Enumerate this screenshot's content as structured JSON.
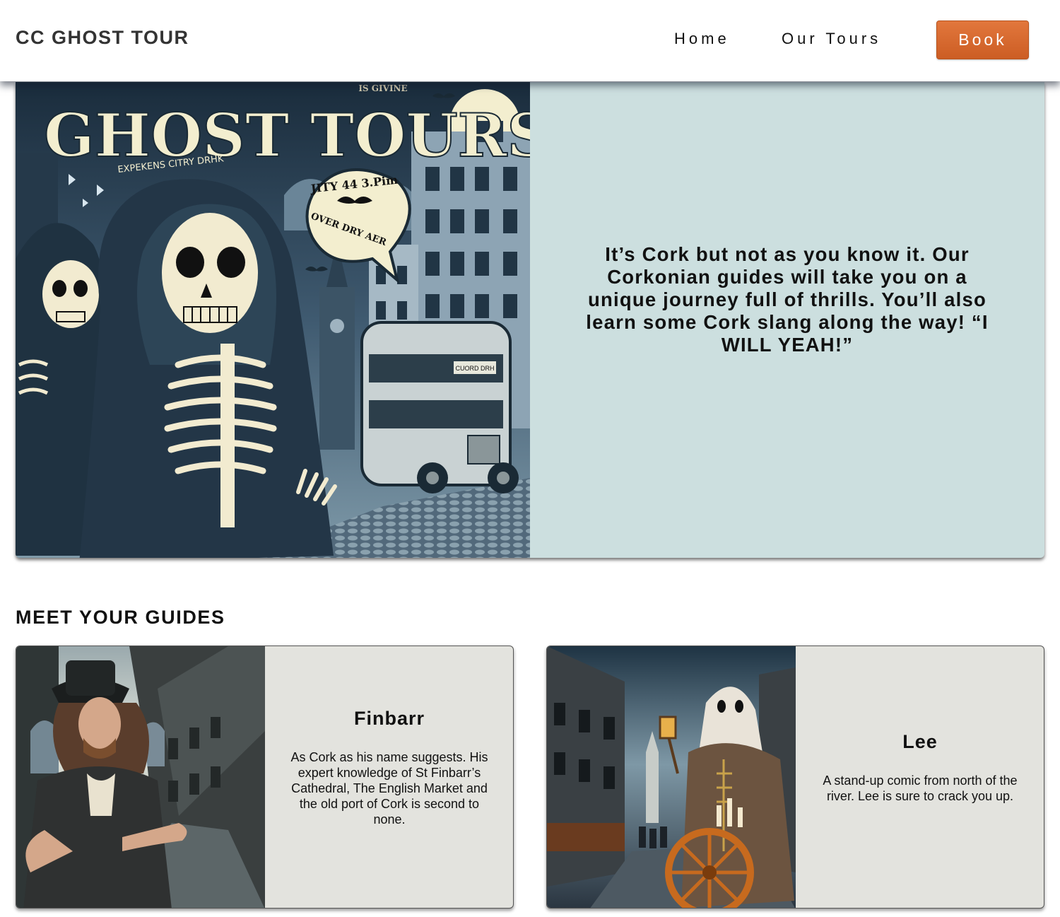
{
  "header": {
    "brand": "CC GHOST TOUR",
    "nav": {
      "home": "Home",
      "tours": "Our Tours"
    },
    "book_label": "Book",
    "accent_color": "#d9692f"
  },
  "hero": {
    "image_text": {
      "small_top": "IS GIVINE",
      "title": "GHOST TOURS",
      "subtitle": "EXPEKENS CITRY DRHK",
      "bubble_line1": "JITY 44 3.Pim",
      "bubble_line2": "OVER DRY AER",
      "bus_sign": "CUORD DRH"
    },
    "text": "It’s Cork but not as you know it. Our Corkonian guides will take you on a unique journey full of thrills. You’ll also learn some Cork slang along the way! “I WILL YEAH!”",
    "panel_color": "#ccdfdf"
  },
  "guides": {
    "title": "MEET YOUR GUIDES",
    "items": [
      {
        "name": "Finbarr",
        "description": "As Cork as his name suggests. His expert knowledge of St Finbarr’s Cathedral, The English Market and the old port of Cork is second to none."
      },
      {
        "name": "Lee",
        "description": "A stand-up comic from north of the river. Lee is sure to crack you up."
      }
    ]
  }
}
